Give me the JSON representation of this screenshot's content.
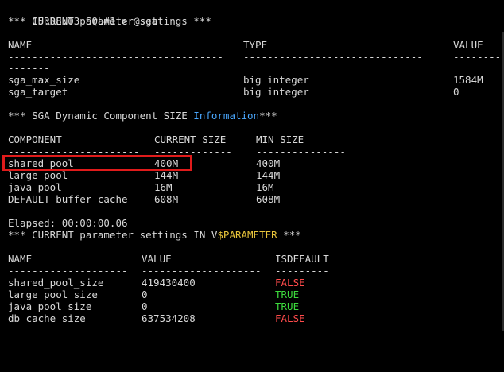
{
  "prompt": {
    "time": "15:08:03",
    "session": "SQL#1",
    "symbol": ">",
    "command": "@sga"
  },
  "section1": {
    "title": "*** CURRENT parameter settings ***",
    "headers": [
      "NAME",
      "TYPE",
      "VALUE"
    ],
    "dashes": [
      "------------------------------------",
      "------------------------------",
      "--------"
    ],
    "dashes_wrap": "-------",
    "rows": [
      [
        "sga_max_size",
        "big integer",
        "1584M"
      ],
      [
        "sga_target",
        "big integer",
        "0"
      ]
    ]
  },
  "section2": {
    "title_prefix": "*** SGA Dynamic Component SIZE ",
    "title_highlight": "Information",
    "title_suffix": "***",
    "headers": [
      "COMPONENT",
      "CURRENT_SIZE",
      "MIN_SIZE"
    ],
    "dashes": [
      "----------------------",
      "-------------",
      "---------------"
    ],
    "rows": [
      [
        "shared pool",
        "400M",
        "400M"
      ],
      [
        "large pool",
        "144M",
        "144M"
      ],
      [
        "java pool",
        "16M",
        "16M"
      ],
      [
        "DEFAULT buffer cache",
        "608M",
        "608M"
      ]
    ]
  },
  "elapsed": "Elapsed: 00:00:00.06",
  "section3": {
    "title_prefix": "*** CURRENT parameter settings IN V",
    "title_highlight": "$PARAMETER",
    "title_suffix": " ***",
    "headers": [
      "NAME",
      "VALUE",
      "ISDEFAULT"
    ],
    "dashes": [
      "--------------------",
      "--------------------",
      "---------"
    ],
    "rows": [
      [
        "shared_pool_size",
        "419430400",
        "FALSE"
      ],
      [
        "large_pool_size",
        "0",
        "TRUE"
      ],
      [
        "java_pool_size",
        "0",
        "TRUE"
      ],
      [
        "db_cache_size",
        "637534208",
        "FALSE"
      ]
    ]
  },
  "colors": {
    "background": "#000000",
    "text": "#d8d8d8",
    "keyword_blue": "#4aa8ff",
    "keyword_gold": "#e8c43a",
    "false": "#ff4b4b",
    "true": "#3cd93c",
    "highlight_box": "#e01b1b"
  }
}
